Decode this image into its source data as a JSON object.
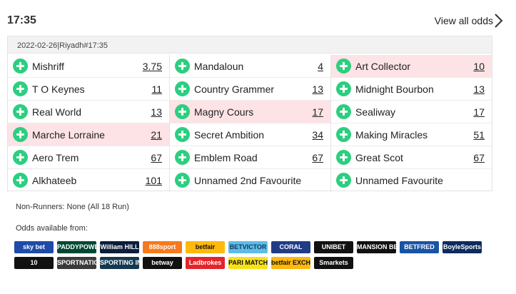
{
  "header": {
    "time": "17:35",
    "view_all": "View all odds"
  },
  "meeting": "2022-02-26|Riyadh#17:35",
  "columns": [
    [
      {
        "name": "Mishriff",
        "odds": "3.75",
        "highlight": false
      },
      {
        "name": "T O Keynes",
        "odds": "11",
        "highlight": false
      },
      {
        "name": "Real World",
        "odds": "13",
        "highlight": false
      },
      {
        "name": "Marche Lorraine",
        "odds": "21",
        "highlight": true
      },
      {
        "name": "Aero Trem",
        "odds": "67",
        "highlight": false
      },
      {
        "name": "Alkhateeb",
        "odds": "101",
        "highlight": false
      }
    ],
    [
      {
        "name": "Mandaloun",
        "odds": "4",
        "highlight": false
      },
      {
        "name": "Country Grammer",
        "odds": "13",
        "highlight": false
      },
      {
        "name": "Magny Cours",
        "odds": "17",
        "highlight": true
      },
      {
        "name": "Secret Ambition",
        "odds": "34",
        "highlight": false
      },
      {
        "name": "Emblem Road",
        "odds": "67",
        "highlight": false
      },
      {
        "name": "Unnamed 2nd Favourite",
        "odds": "",
        "highlight": false
      }
    ],
    [
      {
        "name": "Art Collector",
        "odds": "10",
        "highlight": true
      },
      {
        "name": "Midnight Bourbon",
        "odds": "13",
        "highlight": false
      },
      {
        "name": "Sealiway",
        "odds": "17",
        "highlight": false
      },
      {
        "name": "Making Miracles",
        "odds": "51",
        "highlight": false
      },
      {
        "name": "Great Scot",
        "odds": "67",
        "highlight": false
      },
      {
        "name": "Unnamed Favourite",
        "odds": "",
        "highlight": false
      }
    ]
  ],
  "non_runners": "Non-Runners: None (All 18 Run)",
  "odds_available_label": "Odds available from:",
  "colors": {
    "accent_green": "#2ccf7f",
    "highlight_row": "#fde3e6"
  },
  "bookmakers": [
    [
      {
        "id": "skybet",
        "label": "sky bet",
        "bg": "#1e4aa8",
        "fg": "#ffffff"
      },
      {
        "id": "paddypower",
        "label": "PADDYPOWER.",
        "bg": "#004833",
        "fg": "#ffffff"
      },
      {
        "id": "williamhill",
        "label": "William HILL",
        "bg": "#0b1e3b",
        "fg": "#ffffff"
      },
      {
        "id": "888sport",
        "label": "888sport",
        "bg": "#f67a1d",
        "fg": "#ffffff"
      },
      {
        "id": "betfair",
        "label": "betfair",
        "bg": "#ffb80c",
        "fg": "#111111"
      },
      {
        "id": "betvictor",
        "label": "BETVICTOR",
        "bg": "#5dbde8",
        "fg": "#13365a"
      },
      {
        "id": "coral",
        "label": "CORAL",
        "bg": "#1f3c87",
        "fg": "#ffffff"
      },
      {
        "id": "unibet",
        "label": "UNIBET",
        "bg": "#111111",
        "fg": "#ffffff"
      },
      {
        "id": "mansionbet",
        "label": "MANSION BET",
        "bg": "#111111",
        "fg": "#ffffff"
      },
      {
        "id": "betfred",
        "label": "BETFRED",
        "bg": "#1853a5",
        "fg": "#ffffff"
      },
      {
        "id": "boylesports",
        "label": "BoyleSports",
        "bg": "#0c2b5e",
        "fg": "#ffffff"
      }
    ],
    [
      {
        "id": "10bet",
        "label": "10",
        "bg": "#111111",
        "fg": "#ffffff"
      },
      {
        "id": "sportnation",
        "label": "SPORTNATION",
        "bg": "#3a3a3a",
        "fg": "#ffffff"
      },
      {
        "id": "sportingindex",
        "label": "SPORTING INDEX",
        "bg": "#13384f",
        "fg": "#ffffff"
      },
      {
        "id": "betway",
        "label": "betway",
        "bg": "#111111",
        "fg": "#ffffff"
      },
      {
        "id": "ladbrokes",
        "label": "Ladbrokes",
        "bg": "#e3252b",
        "fg": "#ffffff"
      },
      {
        "id": "parimatch",
        "label": "PARI MATCH",
        "bg": "#f7e21a",
        "fg": "#111111"
      },
      {
        "id": "betfair-exchange",
        "label": "betfair EXCHANGE",
        "bg": "#ffb80c",
        "fg": "#111111"
      },
      {
        "id": "smarkets",
        "label": "Smarkets",
        "bg": "#111111",
        "fg": "#ffffff"
      }
    ]
  ]
}
